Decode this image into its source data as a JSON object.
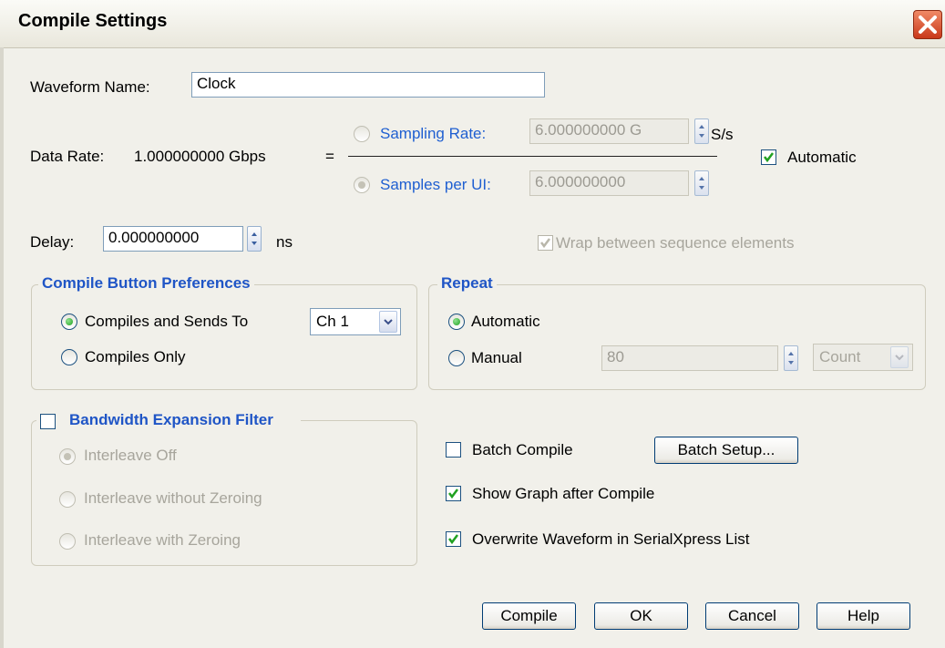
{
  "dialog": {
    "title": "Compile Settings"
  },
  "waveform": {
    "label": "Waveform Name:",
    "value": "Clock"
  },
  "data_rate": {
    "label": "Data Rate:",
    "value": "1.000000000 Gbps",
    "equals": "=",
    "sampling_rate_label": "Sampling Rate:",
    "sampling_rate_value": "6.000000000 G",
    "sampling_rate_unit": "S/s",
    "samples_per_ui_label": "Samples per UI:",
    "samples_per_ui_value": "6.000000000",
    "automatic_label": "Automatic"
  },
  "delay": {
    "label": "Delay:",
    "value": "0.000000000",
    "unit": "ns"
  },
  "wrap": {
    "label": "Wrap between sequence elements"
  },
  "compile_prefs": {
    "title": "Compile Button Preferences",
    "option1": "Compiles and Sends To",
    "channel": "Ch 1",
    "option2": "Compiles Only"
  },
  "repeat": {
    "title": "Repeat",
    "automatic": "Automatic",
    "manual": "Manual",
    "value": "80",
    "unit": "Count"
  },
  "bandwidth": {
    "title": "Bandwidth Expansion Filter",
    "option1": "Interleave Off",
    "option2": "Interleave without Zeroing",
    "option3": "Interleave with Zeroing"
  },
  "options": {
    "batch_compile": "Batch Compile",
    "batch_setup": "Batch Setup...",
    "show_graph": "Show Graph after Compile",
    "overwrite": "Overwrite Waveform in SerialXpress List"
  },
  "buttons": {
    "compile": "Compile",
    "ok": "OK",
    "cancel": "Cancel",
    "help": "Help"
  },
  "colors": {
    "accent": "#1f5fd1",
    "check": "#21a121",
    "close": "#c9381a"
  }
}
